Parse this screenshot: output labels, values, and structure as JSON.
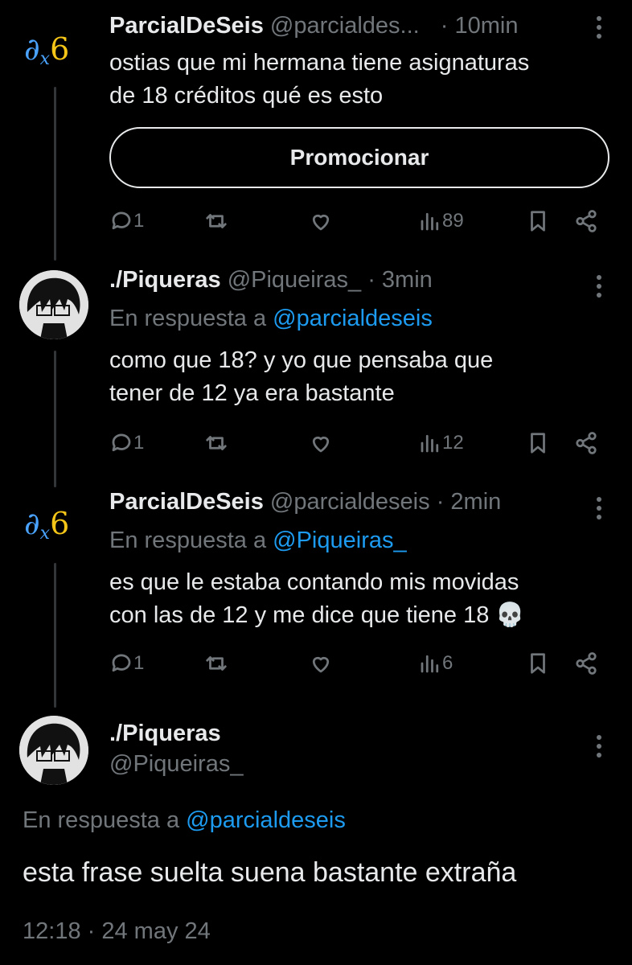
{
  "tweets": [
    {
      "name": "ParcialDeSeis",
      "handle": "@parcialdes...",
      "time": "· 10min",
      "text_line1": "ostias que mi hermana tiene asignaturas",
      "text_line2": "de 18 créditos qué es esto",
      "promote_label": "Promocionar",
      "replies": "1",
      "views": "89"
    },
    {
      "name": "./Piqueras",
      "handle": "@Piqueiras_",
      "time": "· 3min",
      "reply_prefix": "En respuesta a",
      "reply_mention": "@parcialdeseis",
      "text_line1": "como que 18? y yo que pensaba que",
      "text_line2": "tener de 12 ya era bastante",
      "replies": "1",
      "views": "12"
    },
    {
      "name": "ParcialDeSeis",
      "handle": "@parcialdeseis",
      "time": "· 2min",
      "reply_prefix": "En respuesta a",
      "reply_mention": "@Piqueiras_",
      "text_line1": "es que le estaba contando mis movidas",
      "text_line2": "con las de 12 y me dice que tiene 18 💀",
      "replies": "1",
      "views": "6"
    }
  ],
  "main": {
    "name": "./Piqueras",
    "handle": "@Piqueiras_",
    "reply_prefix": "En respuesta a",
    "reply_mention": "@parcialdeseis",
    "text": "esta frase suelta suena bastante extraña",
    "timestamp": "12:18 · 24 may 24"
  },
  "colors": {
    "background": "#000000",
    "text": "#e7e9ea",
    "muted": "#71767b",
    "link": "#1d9bf0"
  }
}
